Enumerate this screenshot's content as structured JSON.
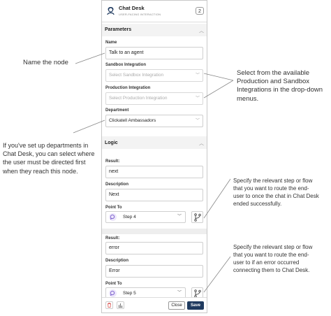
{
  "header": {
    "title": "Chat Desk",
    "subtitle": "USER-FACING INTERACTION",
    "badge": "2"
  },
  "parameters": {
    "section_title": "Parameters",
    "name_label": "Name",
    "name_value": "Talk to an agent",
    "sandbox_label": "Sandbox Integration",
    "sandbox_placeholder": "Select Sandbox Integration",
    "production_label": "Production Integration",
    "production_placeholder": "Select Production Integration",
    "department_label": "Department",
    "department_value": "Clickatell Ambassadors"
  },
  "logic": {
    "section_title": "Logic",
    "outcomes": [
      {
        "result_label": "Result:",
        "result_value": "next",
        "description_label": "Description",
        "description_value": "Next",
        "point_to_label": "Point To",
        "step_value": "Step 4"
      },
      {
        "result_label": "Result:",
        "result_value": "error",
        "description_label": "Description",
        "description_value": "Error",
        "point_to_label": "Point To",
        "step_value": "Step 5"
      }
    ]
  },
  "footer": {
    "close_label": "Close",
    "save_label": "Save"
  },
  "annotations": {
    "name_node": "Name the node",
    "integrations": [
      "Select from the available",
      "Production and Sandbox",
      "Integrations in the drop-down",
      "menus."
    ],
    "department": [
      "If you've set up departments in",
      "Chat Desk, you can select where",
      "the user must be directed first",
      "when they reach this node."
    ],
    "success": [
      "Specify the relevant step or flow",
      "that you want to route the end-",
      "user to once the chat in Chat Desk",
      "ended successfully."
    ],
    "error": [
      "Specify the relevant step or flow",
      "that you want to route the end-",
      "user to if an error occurred",
      "connecting them to Chat Desk."
    ]
  },
  "colors": {
    "save_button": "#1f3a5f",
    "delete_icon": "#d9534f",
    "chat_icon": "#6a4bc4",
    "section_bg": "#f3f3f3"
  },
  "icons": {
    "node": "chat-desk-agent-icon",
    "step": "chat-bubble-icon",
    "branch": "branch-icon",
    "delete": "trash-icon",
    "stats": "bar-chart-icon"
  }
}
